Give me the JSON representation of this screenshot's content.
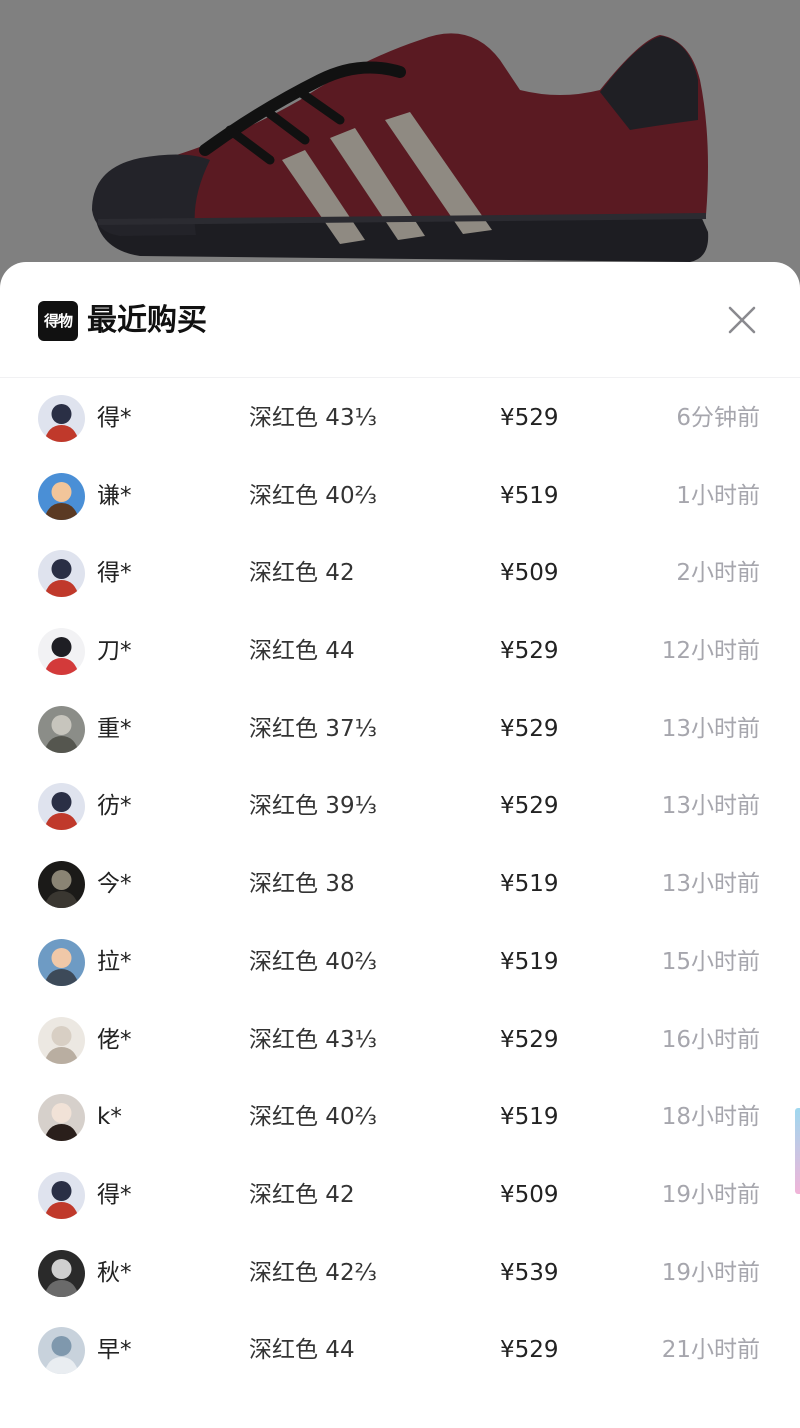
{
  "header": {
    "logo_text": "得物",
    "title": "最近购买",
    "close_icon": "close-icon"
  },
  "colors": {
    "shoe_body": "#5a1a22",
    "shoe_stripes": "#8f8a82",
    "sheet_bg": "#ffffff",
    "time_text": "#a6a6ad"
  },
  "purchases": [
    {
      "name": "得*",
      "spec": "深红色 43⅓",
      "price": "¥529",
      "time": "6分钟前",
      "avatar": "avatar-cartoon-mask"
    },
    {
      "name": "谦*",
      "spec": "深红色 40⅔",
      "price": "¥519",
      "time": "1小时前",
      "avatar": "avatar-cartoon-boy"
    },
    {
      "name": "得*",
      "spec": "深红色 42",
      "price": "¥509",
      "time": "2小时前",
      "avatar": "avatar-cartoon-mask"
    },
    {
      "name": "刀*",
      "spec": "深红色 44",
      "price": "¥529",
      "time": "12小时前",
      "avatar": "avatar-cartoon-red"
    },
    {
      "name": "重*",
      "spec": "深红色 37⅓",
      "price": "¥529",
      "time": "13小时前",
      "avatar": "avatar-photo-grey"
    },
    {
      "name": "彷*",
      "spec": "深红色 39⅓",
      "price": "¥529",
      "time": "13小时前",
      "avatar": "avatar-cartoon-mask"
    },
    {
      "name": "今*",
      "spec": "深红色 38",
      "price": "¥519",
      "time": "13小时前",
      "avatar": "avatar-photo-dark"
    },
    {
      "name": "拉*",
      "spec": "深红色 40⅔",
      "price": "¥519",
      "time": "15小时前",
      "avatar": "avatar-photo-child"
    },
    {
      "name": "佬*",
      "spec": "深红色 43⅓",
      "price": "¥529",
      "time": "16小时前",
      "avatar": "avatar-photo-light"
    },
    {
      "name": "k*",
      "spec": "深红色 40⅔",
      "price": "¥519",
      "time": "18小时前",
      "avatar": "avatar-photo-person"
    },
    {
      "name": "得*",
      "spec": "深红色 42",
      "price": "¥509",
      "time": "19小时前",
      "avatar": "avatar-cartoon-mask"
    },
    {
      "name": "秋*",
      "spec": "深红色 42⅔",
      "price": "¥539",
      "time": "19小时前",
      "avatar": "avatar-photo-bw"
    },
    {
      "name": "早*",
      "spec": "深红色 44",
      "price": "¥529",
      "time": "21小时前",
      "avatar": "avatar-photo-blue"
    }
  ]
}
